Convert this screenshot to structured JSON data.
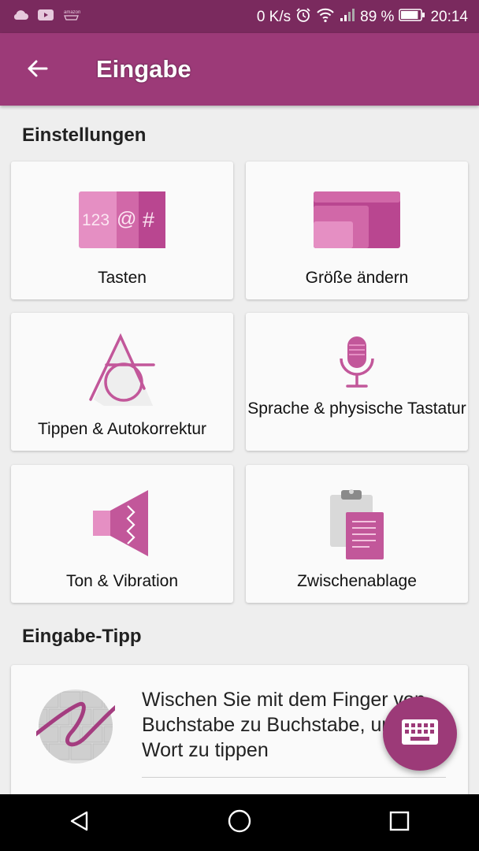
{
  "status_bar": {
    "net_speed": "0 K/s",
    "battery_percent": "89 %",
    "battery_level": 0.89,
    "time": "20:14",
    "left_icons": [
      "cloud-icon",
      "youtube-icon",
      "amazon-icon"
    ],
    "right_icons": [
      "alarm-icon",
      "wifi-icon",
      "signal-icon",
      "battery-icon"
    ]
  },
  "app_bar": {
    "title": "Eingabe",
    "back_icon": "arrow-back-icon"
  },
  "settings": {
    "heading": "Einstellungen",
    "cards": [
      {
        "label": "Tasten",
        "icon": "keys-icon",
        "icon_text": "123 @ #"
      },
      {
        "label": "Größe ändern",
        "icon": "resize-icon"
      },
      {
        "label": "Tippen & Autokorrektur",
        "icon": "typing-icon"
      },
      {
        "label": "Sprache & physische Tastatur",
        "icon": "microphone-icon"
      },
      {
        "label": "Ton & Vibration",
        "icon": "speaker-vibration-icon"
      },
      {
        "label": "Zwischenablage",
        "icon": "clipboard-icon"
      }
    ]
  },
  "tip": {
    "heading": "Eingabe-Tipp",
    "text": "Wischen Sie mit dem Finger von Buchstabe zu Buchstabe, um ein Wort zu tippen",
    "icon": "swipe-typing-icon"
  },
  "fab": {
    "icon": "keyboard-icon"
  },
  "nav_bar": {
    "icons": [
      "back-triangle-icon",
      "home-circle-icon",
      "recents-square-icon"
    ]
  },
  "colors": {
    "status_bar": "#7a2a5e",
    "app_bar": "#9c3a78",
    "accent": "#c2579a",
    "accent_light": "#e58fc3",
    "background": "#eeeeee"
  }
}
